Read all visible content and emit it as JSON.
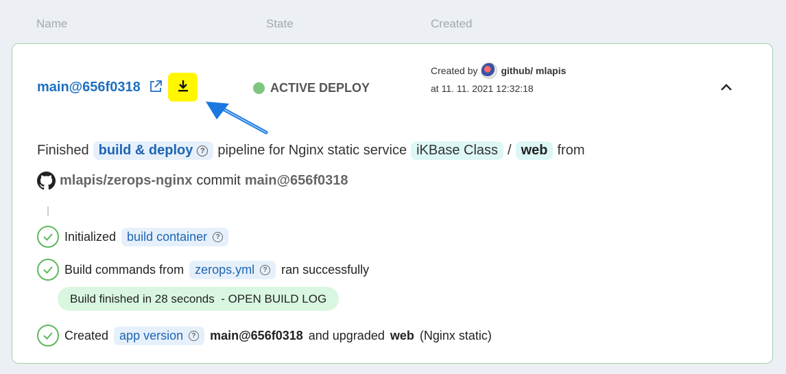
{
  "table_header": {
    "name": "Name",
    "state": "State",
    "created": "Created"
  },
  "deploy": {
    "version_link": "main@656f0318",
    "state": "ACTIVE DEPLOY",
    "created_by_label": "Created by",
    "author": "github/ mlapis",
    "created_at": "at 11. 11. 2021 12:32:18",
    "status_color": "#5cb85c"
  },
  "pipeline": {
    "prefix": "Finished",
    "chip_build_deploy": "build & deploy",
    "middle": "pipeline for Nginx static service",
    "chip_project": "iKBase Class",
    "separator": "/",
    "chip_service": "web",
    "suffix": "from",
    "repo": "mlapis/zerops-nginx",
    "commit_label": "commit",
    "commit_ref": "main@656f0318"
  },
  "steps": [
    {
      "prefix": "Initialized",
      "chip": "build container"
    },
    {
      "prefix": "Build commands from",
      "chip": "zerops.yml",
      "suffix": "ran successfully"
    },
    {
      "prefix": "Created",
      "chip": "app version",
      "bold1": "main@656f0318",
      "middle": "and upgraded",
      "bold2": "web",
      "suffix": "(Nginx static)"
    }
  ],
  "build_log": "Build finished in 28 seconds  - OPEN BUILD LOG",
  "icons": {
    "external": "external-link-icon",
    "download": "download-icon",
    "collapse": "chevron-up-icon",
    "github": "github-icon",
    "help": "help-icon",
    "check": "check-circle-icon",
    "annotation": "annotation-arrow-icon"
  },
  "colors": {
    "link": "#1e6fc0",
    "highlight": "#fff600",
    "success": "#5cb85c",
    "card_border": "#9fd3a9"
  }
}
